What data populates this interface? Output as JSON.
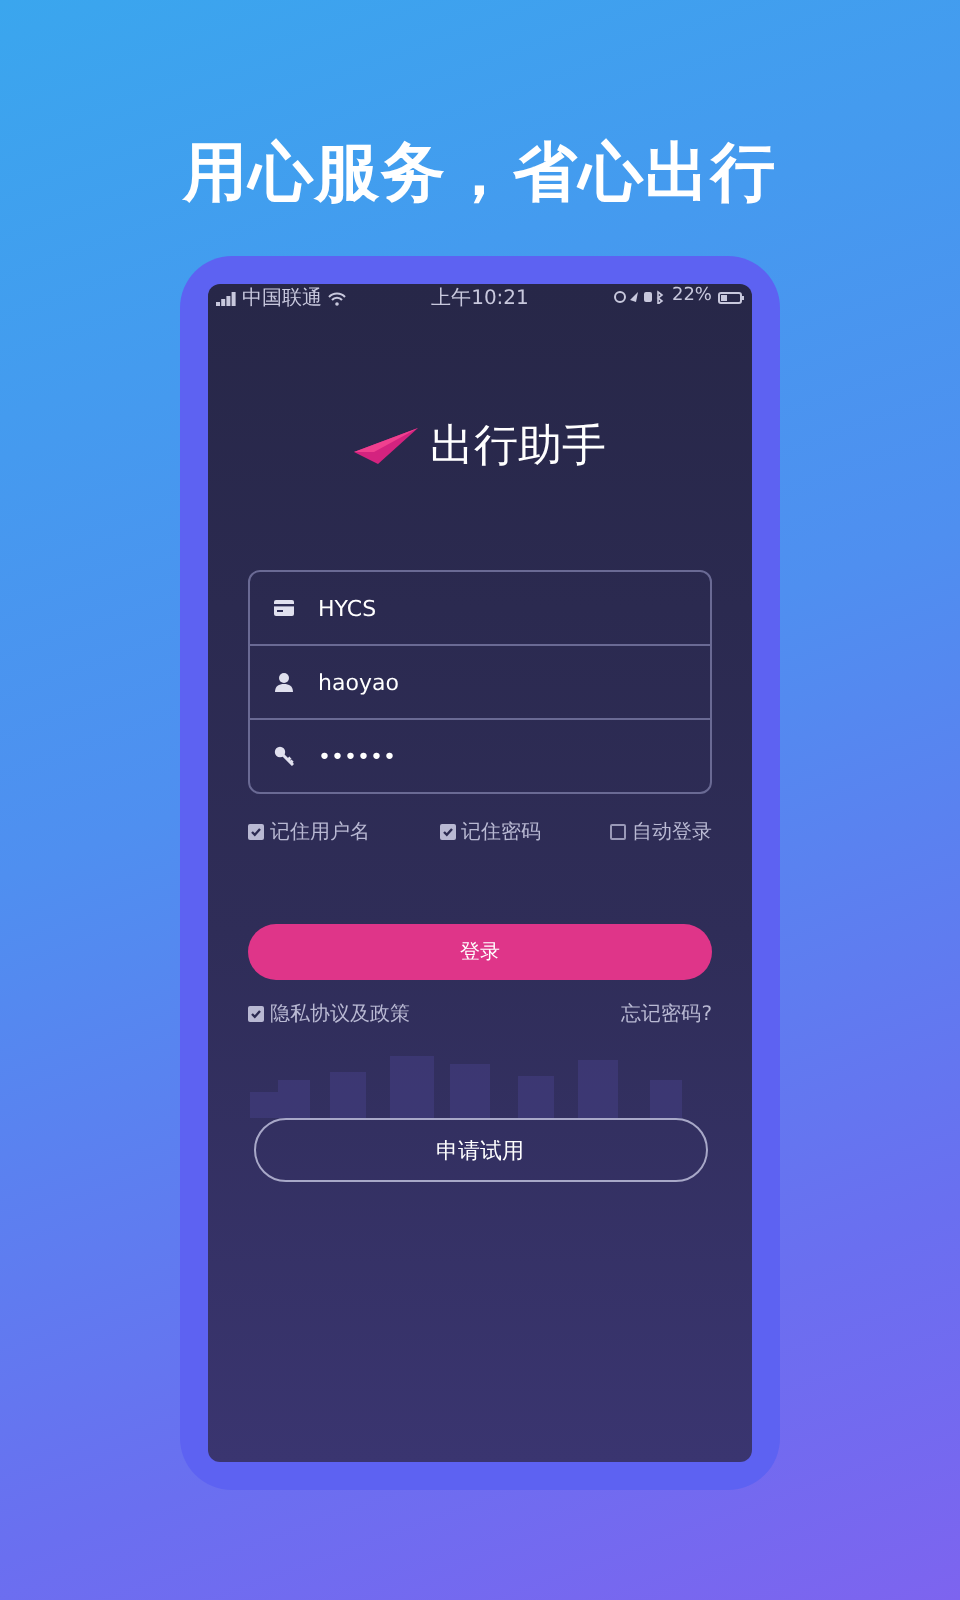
{
  "headline": "用心服务，省心出行",
  "status_bar": {
    "carrier": "中国联通",
    "time": "上午10:21",
    "battery": "22%"
  },
  "app_title": "出行助手",
  "fields": [
    {
      "kind": "company",
      "value": "HYCS"
    },
    {
      "kind": "user",
      "value": "haoyao"
    },
    {
      "kind": "password",
      "value": "••••••"
    }
  ],
  "options": [
    {
      "label": "记住用户名",
      "checked": true
    },
    {
      "label": "记住密码",
      "checked": true
    },
    {
      "label": "自动登录",
      "checked": false
    }
  ],
  "login_button": "登录",
  "privacy": {
    "label": "隐私协议及政策",
    "checked": true
  },
  "forgot_link": "忘记密码?",
  "trial_button": "申请试用"
}
